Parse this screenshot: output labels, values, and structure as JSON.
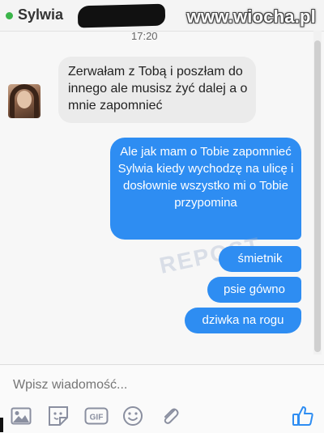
{
  "header": {
    "contact_name": "Sylwia",
    "watermark": "www.wiocha.pl"
  },
  "conversation": {
    "timestamp": "17:20",
    "incoming": [
      "Zerwałam z Tobą i poszłam do innego ale musisz żyć dalej a o mnie zapomnieć"
    ],
    "outgoing": [
      "Ale jak mam o Tobie zapomnieć Sylwia kiedy wychodzę na ulicę i dosłownie wszystko mi o Tobie przypomina",
      "śmietnik",
      "psie gówno",
      "dziwka na rogu"
    ],
    "ghost_watermark": "REPOST"
  },
  "composer": {
    "placeholder": "Wpisz wiadomość..."
  },
  "toolbar": {
    "gif_label": "GIF",
    "icons": [
      "image-icon",
      "sticker-icon",
      "gif-icon",
      "emoji-icon",
      "attachment-icon",
      "like-icon"
    ]
  },
  "colors": {
    "outgoing_bubble": "#2e8df2",
    "incoming_bubble": "#ebebeb",
    "icon": "#8a8fa0",
    "like": "#2e8df2",
    "online": "#3bb54a"
  }
}
